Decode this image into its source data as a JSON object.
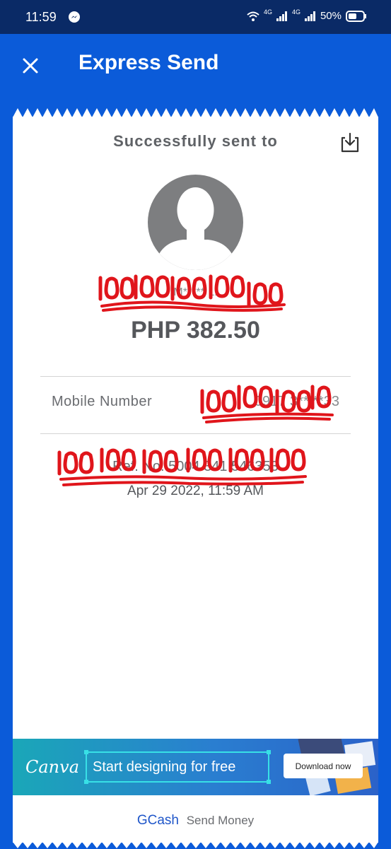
{
  "status_bar": {
    "time": "11:59",
    "network_1": "4G",
    "network_2": "4G",
    "battery": "50%"
  },
  "header": {
    "title": "Express Send",
    "close_icon": "close-icon"
  },
  "receipt": {
    "success_label": "Successfully sent to",
    "download_icon": "download-icon",
    "recipient_name": "M***** L.",
    "amount": "PHP 382.50",
    "mobile_label": "Mobile Number",
    "mobile_value": "0917 3** **33",
    "ref_number": "Ref. No. 5004 341 546353",
    "timestamp": "Apr 29 2022, 11:59 AM"
  },
  "ad": {
    "logo": "Canva",
    "headline": "Start designing for free",
    "cta": "Download now"
  },
  "footer": {
    "brand": "GCash",
    "text": "Send Money"
  },
  "colors": {
    "brand_blue": "#0b5bd9",
    "status_bar": "#0a2a66",
    "redaction_red": "#e0151b"
  }
}
